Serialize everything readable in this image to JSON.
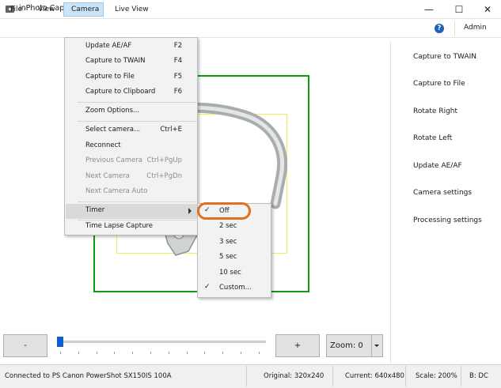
{
  "window": {
    "title": "inPhoto Capture PS",
    "minimize_glyph": "—",
    "maximize_glyph": "☐",
    "close_glyph": "✕"
  },
  "menubar": {
    "items": [
      "File",
      "View",
      "Camera",
      "Live View"
    ],
    "help_glyph": "?",
    "admin": "Admin"
  },
  "right_panel": {
    "buttons": [
      "Capture to TWAIN",
      "Capture to File",
      "Rotate Right",
      "Rotate Left",
      "Update AE/AF",
      "Camera settings",
      "Processing settings"
    ]
  },
  "camera_menu": {
    "items": [
      {
        "label": "Update AE/AF",
        "shortcut": "F2",
        "enabled": true
      },
      {
        "label": "Capture to TWAIN",
        "shortcut": "F4",
        "enabled": true
      },
      {
        "label": "Capture to File",
        "shortcut": "F5",
        "enabled": true
      },
      {
        "label": "Capture to Clipboard",
        "shortcut": "F6",
        "enabled": true
      },
      {
        "label": "Zoom Options...",
        "shortcut": "",
        "enabled": true
      },
      {
        "label": "Select camera...",
        "shortcut": "Ctrl+E",
        "enabled": true
      },
      {
        "label": "Reconnect",
        "shortcut": "",
        "enabled": true
      },
      {
        "label": "Previous Camera",
        "shortcut": "Ctrl+PgUp",
        "enabled": false
      },
      {
        "label": "Next Camera",
        "shortcut": "Ctrl+PgDn",
        "enabled": false
      },
      {
        "label": "Next Camera Auto",
        "shortcut": "",
        "enabled": false
      },
      {
        "label": "Timer",
        "shortcut": "",
        "enabled": true
      },
      {
        "label": "Time Lapse Capture",
        "shortcut": "",
        "enabled": true
      }
    ]
  },
  "timer_submenu": {
    "items": [
      {
        "label": "Off",
        "checked": true
      },
      {
        "label": "2 sec",
        "checked": false
      },
      {
        "label": "3 sec",
        "checked": false
      },
      {
        "label": "5 sec",
        "checked": false
      },
      {
        "label": "10 sec",
        "checked": false
      },
      {
        "label": "Custom...",
        "checked": true
      }
    ],
    "check_glyph": "✓"
  },
  "controls": {
    "minus": "-",
    "plus": "+",
    "zoom": "Zoom: 0",
    "zoom_level": 0
  },
  "status": {
    "connection": "Connected to PS Canon PowerShot SX150IS 100A",
    "original": "Original: 320x240",
    "current": "Current: 640x480",
    "scale": "Scale: 200%",
    "b": "B: DC"
  },
  "colors": {
    "accent_orange": "#e0701e",
    "frame_green": "#119911",
    "frame_yellow": "#f0ee5a",
    "slider_blue": "#0c5fc9"
  }
}
